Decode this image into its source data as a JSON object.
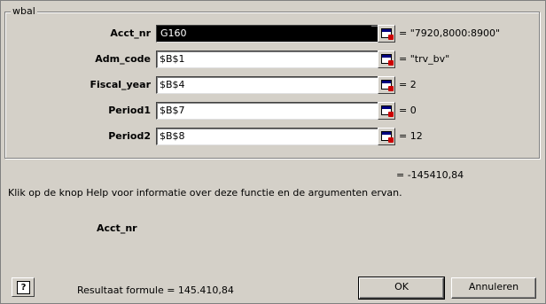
{
  "group": {
    "title": "wbal"
  },
  "args": [
    {
      "label": "Acct_nr",
      "value": "G160",
      "result": "= \"7920,8000:8900\""
    },
    {
      "label": "Adm_code",
      "value": "$B$1",
      "result": "= \"trv_bv\""
    },
    {
      "label": "Fiscal_year",
      "value": "$B$4",
      "result": "= 2"
    },
    {
      "label": "Period1",
      "value": "$B$7",
      "result": "= 0"
    },
    {
      "label": "Period2",
      "value": "$B$8",
      "result": "= 12"
    }
  ],
  "formula_result": "= -145410,84",
  "description": "Klik op de knop Help voor informatie over deze functie en de argumenten ervan.",
  "current_arg": "Acct_nr",
  "result_line": "Resultaat formule =  145.410,84",
  "buttons": {
    "help": "?",
    "ok": "OK",
    "cancel": "Annuleren"
  },
  "icons": {
    "collapse": "collapse-dialog-icon",
    "help": "help-icon"
  }
}
